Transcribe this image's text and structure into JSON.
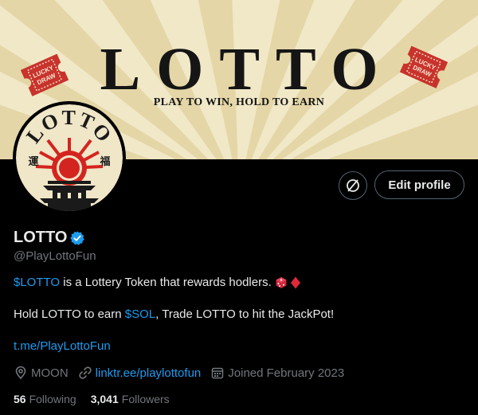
{
  "banner": {
    "title": "LOTTO",
    "tagline": "PLAY TO WIN, HOLD TO EARN",
    "ticket_text": "LUCKY DRAW"
  },
  "avatar": {
    "logo_text": "LOTTO",
    "left_kanji": "運",
    "right_kanji": "福"
  },
  "actions": {
    "icon_button": "disconnect-icon",
    "edit_profile_label": "Edit profile"
  },
  "profile": {
    "display_name": "LOTTO",
    "handle": "@PlayLottoFun",
    "bio_line1": {
      "cashtag": "$LOTTO",
      "text": " is a Lottery Token that rewards hodlers. ",
      "emojis": [
        "dice-icon",
        "diamond-icon"
      ]
    },
    "bio_line2": {
      "before": "Hold LOTTO to earn ",
      "cashtag": "$SOL",
      "after": ", Trade LOTTO to hit the JackPot!"
    },
    "bio_link": "t.me/PlayLottoFun",
    "location": "MOON",
    "website": "linktr.ee/playlottofun",
    "joined": "Joined February 2023"
  },
  "stats": {
    "following_count": "56",
    "following_label": "Following",
    "followers_count": "3,041",
    "followers_label": "Followers"
  },
  "colors": {
    "link": "#1d9bf0",
    "muted": "#71767b",
    "text": "#e7e9ea",
    "banner_bg": "#f1e8c8",
    "ticket_red": "#c8332c"
  }
}
